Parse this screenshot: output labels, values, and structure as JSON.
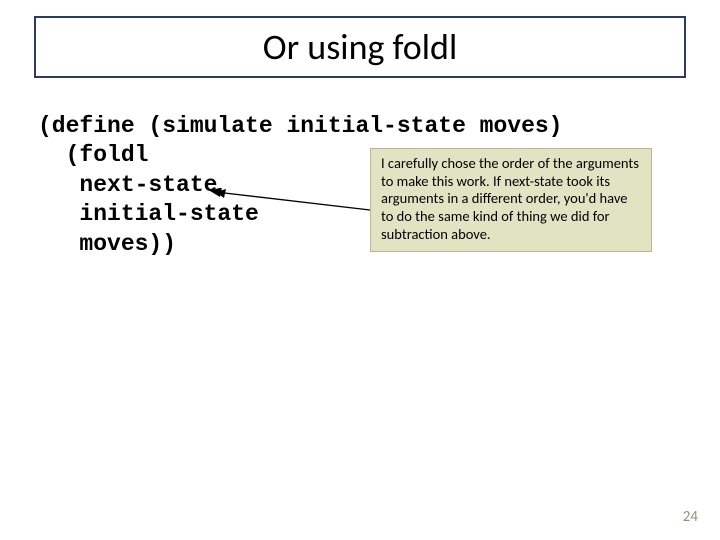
{
  "title": "Or using foldl",
  "code": {
    "line1": "(define (simulate initial-state moves)",
    "line2": "  (foldl",
    "line3": "   next-state",
    "line4": "   initial-state",
    "line5": "   moves))"
  },
  "callout_text": "I carefully chose the order of the arguments to make this work.  If next-state took its arguments in a different order, you'd have to do the same kind of thing we did for subtraction above.",
  "page_number": "24"
}
